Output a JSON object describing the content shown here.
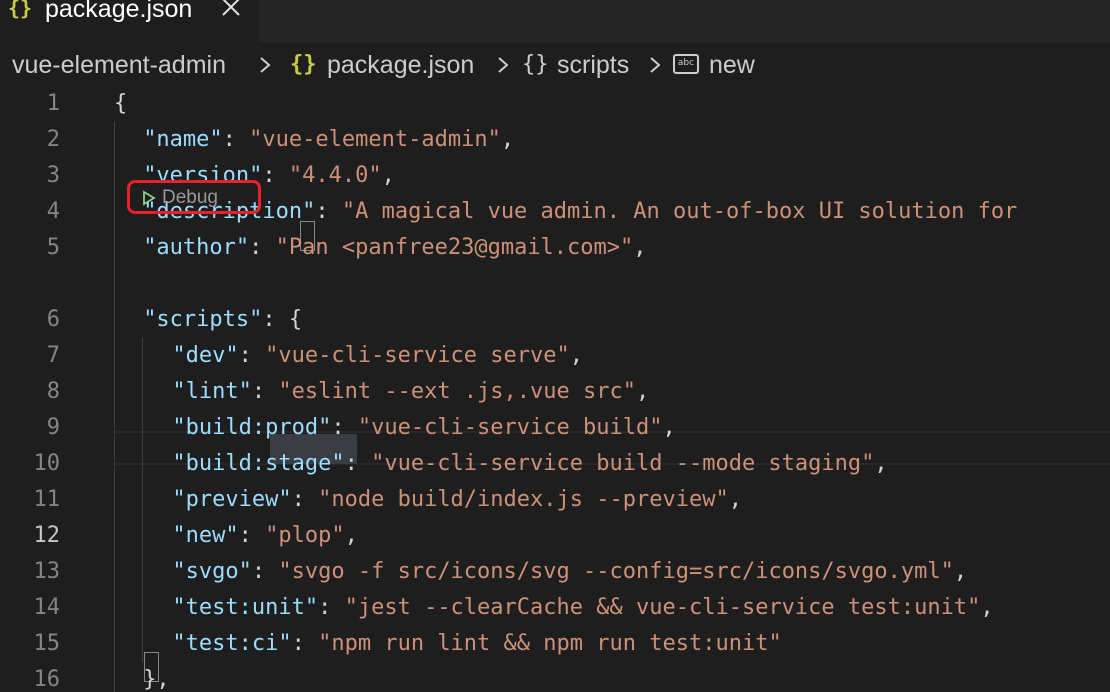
{
  "tab": {
    "icon": "{}",
    "label": "package.json"
  },
  "breadcrumb": {
    "items": [
      "vue-element-admin",
      "package.json",
      "scripts",
      "new"
    ],
    "json_icon": "{}",
    "object_icon": "{}",
    "string_icon": "abc"
  },
  "codelens": {
    "label": "Debug"
  },
  "lines": [
    {
      "num": "1",
      "parts": [
        {
          "t": "p",
          "v": "{"
        }
      ]
    },
    {
      "num": "2",
      "parts": [
        {
          "t": "k",
          "v": "\"name\""
        },
        {
          "t": "p",
          "v": ": "
        },
        {
          "t": "s",
          "v": "\"vue-element-admin\""
        },
        {
          "t": "p",
          "v": ","
        }
      ]
    },
    {
      "num": "3",
      "parts": [
        {
          "t": "k",
          "v": "\"version\""
        },
        {
          "t": "p",
          "v": ": "
        },
        {
          "t": "s",
          "v": "\"4.4.0\""
        },
        {
          "t": "p",
          "v": ","
        }
      ]
    },
    {
      "num": "4",
      "parts": [
        {
          "t": "k",
          "v": "\"description\""
        },
        {
          "t": "p",
          "v": ": "
        },
        {
          "t": "s",
          "v": "\"A magical vue admin. An out-of-box UI solution for"
        }
      ]
    },
    {
      "num": "5",
      "parts": [
        {
          "t": "k",
          "v": "\"author\""
        },
        {
          "t": "p",
          "v": ": "
        },
        {
          "t": "s",
          "v": "\"Pan <panfree23@gmail.com>\""
        },
        {
          "t": "p",
          "v": ","
        }
      ]
    },
    {
      "num": "6",
      "parts": [
        {
          "t": "k",
          "v": "\"scripts\""
        },
        {
          "t": "p",
          "v": ": {"
        }
      ]
    },
    {
      "num": "7",
      "parts": [
        {
          "t": "k",
          "v": "\"dev\""
        },
        {
          "t": "p",
          "v": ": "
        },
        {
          "t": "s",
          "v": "\"vue-cli-service serve\""
        },
        {
          "t": "p",
          "v": ","
        }
      ]
    },
    {
      "num": "8",
      "parts": [
        {
          "t": "k",
          "v": "\"lint\""
        },
        {
          "t": "p",
          "v": ": "
        },
        {
          "t": "s",
          "v": "\"eslint --ext .js,.vue src\""
        },
        {
          "t": "p",
          "v": ","
        }
      ]
    },
    {
      "num": "9",
      "parts": [
        {
          "t": "k",
          "v": "\"build:prod\""
        },
        {
          "t": "p",
          "v": ": "
        },
        {
          "t": "s",
          "v": "\"vue-cli-service build\""
        },
        {
          "t": "p",
          "v": ","
        }
      ]
    },
    {
      "num": "10",
      "parts": [
        {
          "t": "k",
          "v": "\"build:stage\""
        },
        {
          "t": "p",
          "v": ": "
        },
        {
          "t": "s",
          "v": "\"vue-cli-service build --mode staging\""
        },
        {
          "t": "p",
          "v": ","
        }
      ]
    },
    {
      "num": "11",
      "parts": [
        {
          "t": "k",
          "v": "\"preview\""
        },
        {
          "t": "p",
          "v": ": "
        },
        {
          "t": "s",
          "v": "\"node build/index.js --preview\""
        },
        {
          "t": "p",
          "v": ","
        }
      ]
    },
    {
      "num": "12",
      "parts": [
        {
          "t": "k",
          "v": "\"new\""
        },
        {
          "t": "p",
          "v": ": "
        },
        {
          "t": "s",
          "v": "\"plop\""
        },
        {
          "t": "p",
          "v": ","
        }
      ]
    },
    {
      "num": "13",
      "parts": [
        {
          "t": "k",
          "v": "\"svgo\""
        },
        {
          "t": "p",
          "v": ": "
        },
        {
          "t": "s",
          "v": "\"svgo -f src/icons/svg --config=src/icons/svgo.yml\""
        },
        {
          "t": "p",
          "v": ","
        }
      ]
    },
    {
      "num": "14",
      "parts": [
        {
          "t": "k",
          "v": "\"test:unit\""
        },
        {
          "t": "p",
          "v": ": "
        },
        {
          "t": "s",
          "v": "\"jest --clearCache && vue-cli-service test:unit\""
        },
        {
          "t": "p",
          "v": ","
        }
      ]
    },
    {
      "num": "15",
      "parts": [
        {
          "t": "k",
          "v": "\"test:ci\""
        },
        {
          "t": "p",
          "v": ": "
        },
        {
          "t": "s",
          "v": "\"npm run lint && npm run test:unit\""
        }
      ]
    },
    {
      "num": "16",
      "parts": [
        {
          "t": "p",
          "v": "},"
        }
      ]
    }
  ],
  "active_line": "12",
  "colors": {
    "key": "#9cdcfe",
    "string": "#ce9178",
    "punctuation": "#d4d4d4",
    "json_icon": "#cbcb41",
    "highlight_box": "#e8212b",
    "debug_icon": "#89d185"
  }
}
